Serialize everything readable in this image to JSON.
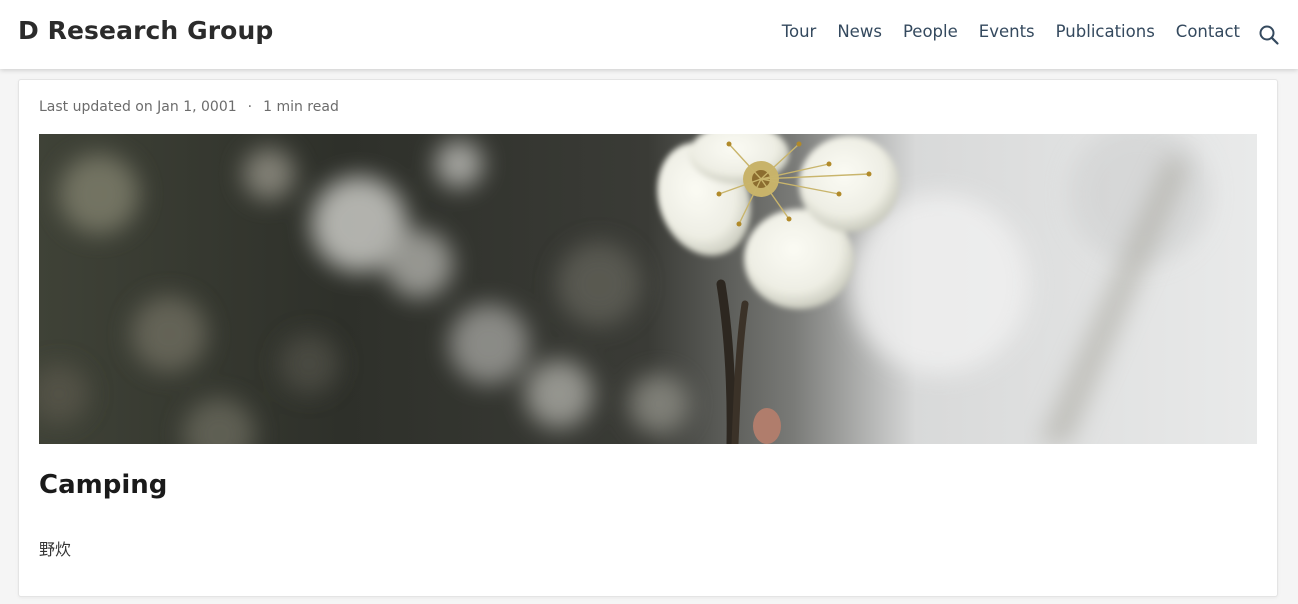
{
  "navbar": {
    "brand": "D Research Group",
    "links": [
      "Tour",
      "News",
      "People",
      "Events",
      "Publications",
      "Contact"
    ],
    "search_icon": "search-icon"
  },
  "post": {
    "last_updated": "Last updated on Jan 1, 0001",
    "separator": "·",
    "read_time": "1 min read",
    "hero_image": "plum-blossom-photo",
    "title": "Camping",
    "body": "野炊"
  }
}
